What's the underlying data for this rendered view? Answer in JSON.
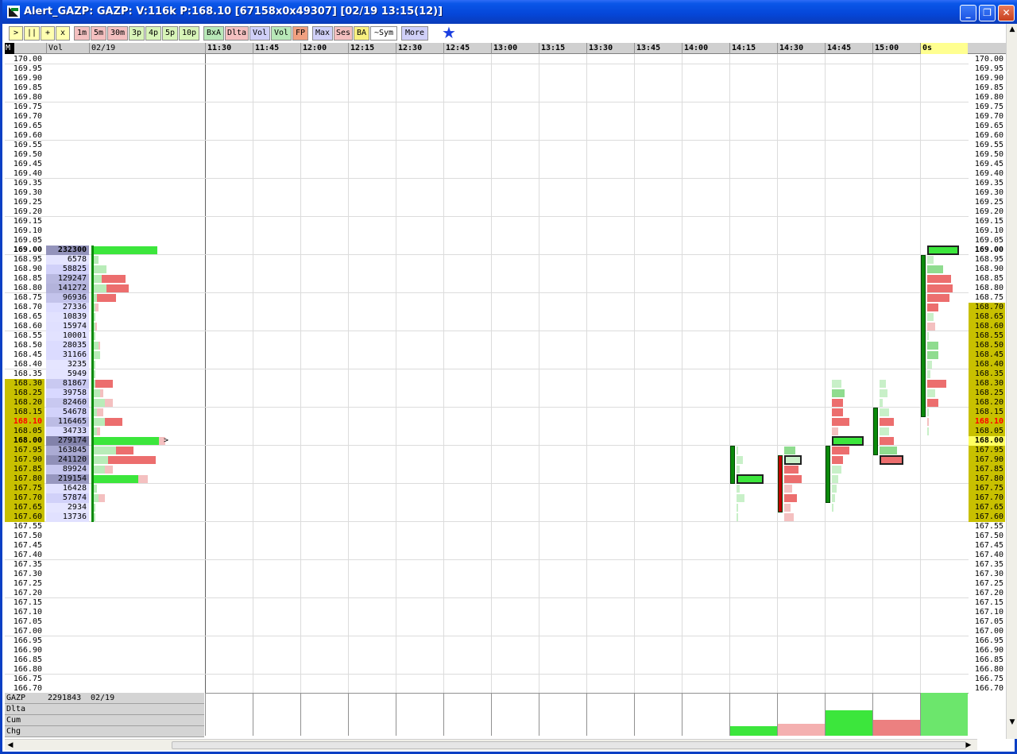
{
  "window": {
    "title": "Alert_GAZP: GAZP: V:116k P:168.10 [67158x0x49307] [02/19 13:15(12)]",
    "controls": {
      "minimize": "_",
      "maximize": "❐",
      "close": "✕"
    }
  },
  "toolbar": {
    "buttons": [
      {
        "label": ">",
        "color": "#ffffb0"
      },
      {
        "label": "||",
        "color": "#ffffb0"
      },
      {
        "label": "+",
        "color": "#ffffb0"
      },
      {
        "label": "x",
        "color": "#ffffb0"
      },
      {
        "label": "1m",
        "color": "#f4c0c0"
      },
      {
        "label": "5m",
        "color": "#f4c0c0"
      },
      {
        "label": "30m",
        "color": "#f4c0c0"
      },
      {
        "label": "3p",
        "color": "#d8f4b8"
      },
      {
        "label": "4p",
        "color": "#d8f4b8"
      },
      {
        "label": "5p",
        "color": "#d8f4b8"
      },
      {
        "label": "10p",
        "color": "#d8f4b8"
      },
      {
        "label": "BxA",
        "color": "#b8e8b8"
      },
      {
        "label": "Dlta",
        "color": "#f4c0c0"
      },
      {
        "label": "Vol",
        "color": "#d0d0f8"
      },
      {
        "label": "Vol",
        "color": "#b8e8b8"
      },
      {
        "label": "FP",
        "color": "#f0a080"
      },
      {
        "label": "Max",
        "color": "#d0d0f8"
      },
      {
        "label": "Ses",
        "color": "#f4c0c0"
      },
      {
        "label": "BA",
        "color": "#f8f080"
      },
      {
        "label": "~Sym",
        "color": "#ffffff"
      },
      {
        "label": "More",
        "color": "#d0d0f8"
      }
    ],
    "star_icon": "star-icon"
  },
  "header": {
    "mode": "M",
    "vol": "Vol",
    "date": "02/19",
    "times": [
      "11:30",
      "11:45",
      "12:00",
      "12:15",
      "12:30",
      "12:45",
      "13:00",
      "13:15",
      "13:30",
      "13:45",
      "14:00",
      "14:15",
      "14:30",
      "14:45",
      "15:00"
    ],
    "current_label": "0s"
  },
  "price_levels": [
    "170.00",
    "169.95",
    "169.90",
    "169.85",
    "169.80",
    "169.75",
    "169.70",
    "169.65",
    "169.60",
    "169.55",
    "169.50",
    "169.45",
    "169.40",
    "169.35",
    "169.30",
    "169.25",
    "169.20",
    "169.15",
    "169.10",
    "169.05",
    "169.00",
    "168.95",
    "168.90",
    "168.85",
    "168.80",
    "168.75",
    "168.70",
    "168.65",
    "168.60",
    "168.55",
    "168.50",
    "168.45",
    "168.40",
    "168.35",
    "168.30",
    "168.25",
    "168.20",
    "168.15",
    "168.10",
    "168.05",
    "168.00",
    "167.95",
    "167.90",
    "167.85",
    "167.80",
    "167.75",
    "167.70",
    "167.65",
    "167.60",
    "167.55",
    "167.50",
    "167.45",
    "167.40",
    "167.35",
    "167.30",
    "167.25",
    "167.20",
    "167.15",
    "167.10",
    "167.05",
    "167.00",
    "166.95",
    "166.90",
    "166.85",
    "166.80",
    "166.75",
    "166.70"
  ],
  "current_price": "168.10",
  "volumes": [
    {
      "price": "169.00",
      "vol": "232300"
    },
    {
      "price": "168.95",
      "vol": "6578"
    },
    {
      "price": "168.90",
      "vol": "58825"
    },
    {
      "price": "168.85",
      "vol": "129247"
    },
    {
      "price": "168.80",
      "vol": "141272"
    },
    {
      "price": "168.75",
      "vol": "96936"
    },
    {
      "price": "168.70",
      "vol": "27336"
    },
    {
      "price": "168.65",
      "vol": "10839"
    },
    {
      "price": "168.60",
      "vol": "15974"
    },
    {
      "price": "168.55",
      "vol": "10001"
    },
    {
      "price": "168.50",
      "vol": "28035"
    },
    {
      "price": "168.45",
      "vol": "31166"
    },
    {
      "price": "168.40",
      "vol": "3235"
    },
    {
      "price": "168.35",
      "vol": "5949"
    },
    {
      "price": "168.30",
      "vol": "81867"
    },
    {
      "price": "168.25",
      "vol": "39758"
    },
    {
      "price": "168.20",
      "vol": "82460"
    },
    {
      "price": "168.15",
      "vol": "54678"
    },
    {
      "price": "168.10",
      "vol": "116465"
    },
    {
      "price": "168.05",
      "vol": "34733"
    },
    {
      "price": "168.00",
      "vol": "279174"
    },
    {
      "price": "167.95",
      "vol": "163845"
    },
    {
      "price": "167.90",
      "vol": "241120"
    },
    {
      "price": "167.85",
      "vol": "89924"
    },
    {
      "price": "167.80",
      "vol": "219154"
    },
    {
      "price": "167.75",
      "vol": "16428"
    },
    {
      "price": "167.70",
      "vol": "57874"
    },
    {
      "price": "167.65",
      "vol": "2934"
    },
    {
      "price": "167.60",
      "vol": "13736"
    }
  ],
  "poc_marker": ">",
  "footer": {
    "symbol": "GAZP",
    "total_vol": "2291843",
    "date": "02/19",
    "rows": [
      "Dlta",
      "Cum",
      "Chg"
    ]
  },
  "colors": {
    "buy": "#3ce63c",
    "buy_light": "#b8ecb8",
    "sell": "#ec6e6e",
    "sell_light": "#f4c0c0",
    "value_area": "#c8c000",
    "vol_cell": "#9090d0",
    "current_price": "#ff0000"
  },
  "scroll": {
    "left": "◀",
    "right": "▶",
    "up": "▲",
    "down": "▼"
  }
}
